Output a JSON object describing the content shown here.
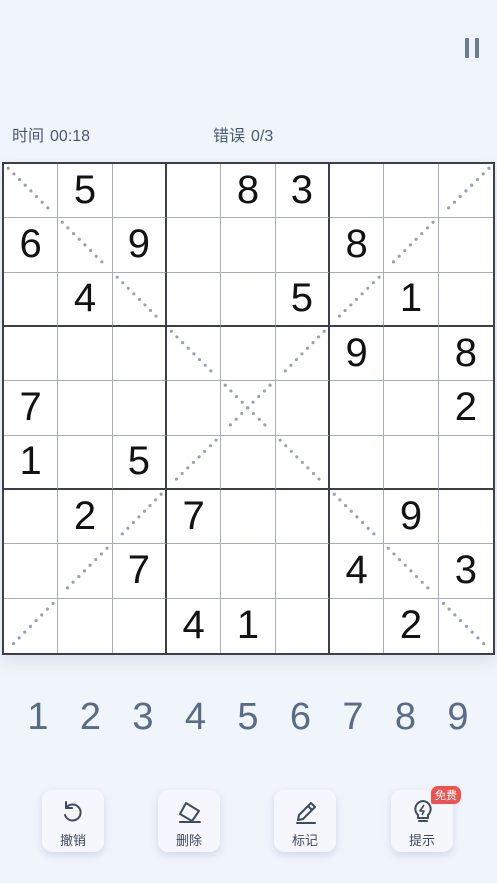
{
  "controls": {
    "pause_icon": "pause-icon"
  },
  "status": {
    "time_label": "时间",
    "time_value": "00:18",
    "errors_label": "错误",
    "errors_value": "0/3"
  },
  "board": {
    "variant": "x-sudoku (diagonals marked)",
    "rows": [
      [
        "",
        "5",
        "",
        "",
        "8",
        "3",
        "",
        "",
        ""
      ],
      [
        "6",
        "",
        "9",
        "",
        "",
        "",
        "8",
        "",
        ""
      ],
      [
        "",
        "4",
        "",
        "",
        "",
        "5",
        "",
        "1",
        ""
      ],
      [
        "",
        "",
        "",
        "",
        "",
        "",
        "9",
        "",
        "8"
      ],
      [
        "7",
        "",
        "",
        "",
        "",
        "",
        "",
        "",
        "2"
      ],
      [
        "1",
        "",
        "5",
        "",
        "",
        "",
        "",
        "",
        ""
      ],
      [
        "",
        "2",
        "",
        "7",
        "",
        "",
        "",
        "9",
        ""
      ],
      [
        "",
        "",
        "7",
        "",
        "",
        "",
        "4",
        "",
        "3"
      ],
      [
        "",
        "",
        "",
        "4",
        "1",
        "",
        "",
        "2",
        ""
      ]
    ],
    "colors": {
      "thick_line": "#3c3f47",
      "thin_line": "#a7adb8",
      "diagonal_dots": "#9aa1ad",
      "digit": "#121212"
    }
  },
  "numpad": [
    "1",
    "2",
    "3",
    "4",
    "5",
    "6",
    "7",
    "8",
    "9"
  ],
  "tools": [
    {
      "label": "撤销",
      "icon": "undo-icon"
    },
    {
      "label": "删除",
      "icon": "eraser-icon"
    },
    {
      "label": "标记",
      "icon": "pencil-icon"
    },
    {
      "label": "提示",
      "icon": "lightbulb-icon"
    }
  ],
  "hint_badge": "免费",
  "accent": {
    "numpad_text": "#5a6b88",
    "badge": "#ef5350"
  }
}
